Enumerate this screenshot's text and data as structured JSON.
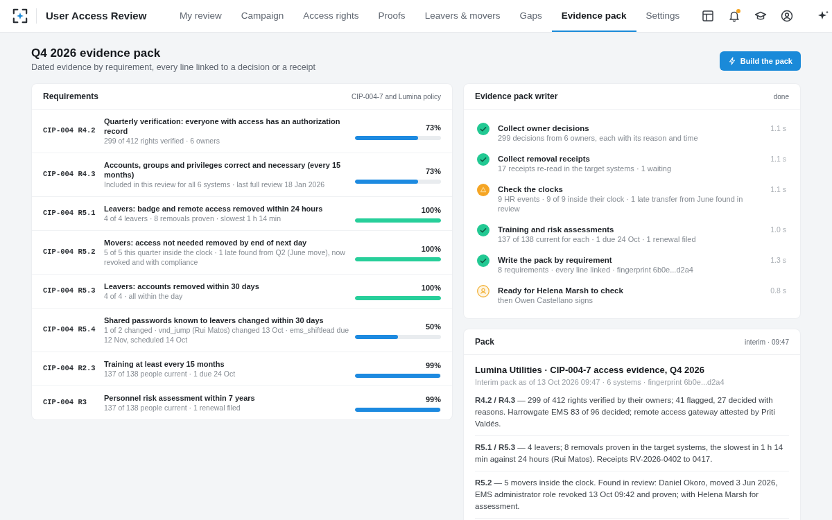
{
  "app": {
    "title": "User Access Review"
  },
  "nav_tabs": [
    {
      "label": "My review",
      "selected": false
    },
    {
      "label": "Campaign",
      "selected": false
    },
    {
      "label": "Access rights",
      "selected": false
    },
    {
      "label": "Proofs",
      "selected": false
    },
    {
      "label": "Leavers & movers",
      "selected": false
    },
    {
      "label": "Gaps",
      "selected": false
    },
    {
      "label": "Evidence pack",
      "selected": true
    },
    {
      "label": "Settings",
      "selected": false
    }
  ],
  "toolbar": {
    "unread_notifications": true
  },
  "header": {
    "title": "Q4 2026 evidence pack",
    "subtitle": "Dated evidence by requirement, every line linked to a decision or a receipt",
    "button": "Build the pack"
  },
  "requirements": {
    "title": "Requirements",
    "source": "CIP-004-7 and Lumina policy",
    "rows": [
      {
        "code": "CIP-004 R4.2",
        "title": "Quarterly verification: everyone with access has an authorization record",
        "detail": "299 of 412 rights verified · 6 owners",
        "percent": "73%",
        "level": 0.73
      },
      {
        "code": "CIP-004 R4.3",
        "title": "Accounts, groups and privileges correct and necessary (every 15 months)",
        "detail": "Included in this review for all 6 systems · last full review 18 Jan 2026",
        "percent": "73%",
        "level": 0.73
      },
      {
        "code": "CIP-004 R5.1",
        "title": "Leavers: badge and remote access removed within 24 hours",
        "detail": "4 of 4 leavers · 8 removals proven · slowest 1 h 14 min",
        "percent": "100%",
        "level": 1
      },
      {
        "code": "CIP-004 R5.2",
        "title": "Movers: access not needed removed by end of next day",
        "detail": "5 of 5 this quarter inside the clock · 1 late found from Q2 (June move), now revoked and with compliance",
        "percent": "100%",
        "level": 1
      },
      {
        "code": "CIP-004 R5.3",
        "title": "Leavers: accounts removed within 30 days",
        "detail": "4 of 4 · all within the day",
        "percent": "100%",
        "level": 1
      },
      {
        "code": "CIP-004 R5.4",
        "title": "Shared passwords known to leavers changed within 30 days",
        "detail": "1 of 2 changed · vnd_jump (Rui Matos) changed 13 Oct · ems_shiftlead due 12 Nov, scheduled 14 Oct",
        "percent": "50%",
        "level": 0.5
      },
      {
        "code": "CIP-004 R2.3",
        "title": "Training at least every 15 months",
        "detail": "137 of 138 people current · 1 due 24 Oct",
        "percent": "99%",
        "level": 0.99
      },
      {
        "code": "CIP-004 R3",
        "title": "Personnel risk assessment within 7 years",
        "detail": "137 of 138 people current · 1 renewal filed",
        "percent": "99%",
        "level": 0.99
      }
    ]
  },
  "writer": {
    "title": "Evidence pack writer",
    "status": "done",
    "steps": [
      {
        "kind": "done",
        "title": "Collect owner decisions",
        "detail": "299 decisions from 6 owners, each with its reason and time",
        "duration": "1.1 s"
      },
      {
        "kind": "done",
        "title": "Collect removal receipts",
        "detail": "17 receipts re-read in the target systems · 1 waiting",
        "duration": "1.1 s"
      },
      {
        "kind": "warning",
        "title": "Check the clocks",
        "detail": "9 HR events · 9 of 9 inside their clock · 1 late transfer from June found in review",
        "duration": "1.1 s"
      },
      {
        "kind": "done",
        "title": "Training and risk assessments",
        "detail": "137 of 138 current for each · 1 due 24 Oct · 1 renewal filed",
        "duration": "1.0 s"
      },
      {
        "kind": "done",
        "title": "Write the pack by requirement",
        "detail": "8 requirements · every line linked · fingerprint 6b0e...d2a4",
        "duration": "1.3 s"
      },
      {
        "kind": "review",
        "title": "Ready for Helena Marsh to check",
        "detail": "then Owen Castellano signs",
        "duration": "0.8 s"
      }
    ]
  },
  "pack": {
    "title": "Pack",
    "status": "interim · 09:47",
    "heading": "Lumina Utilities · CIP-004-7 access evidence, Q4 2026",
    "meta": "Interim pack as of 13 Oct 2026 09:47 · 6 systems · fingerprint 6b0e...d2a4",
    "sections": [
      "**R4.2 / R4.3** — 299 of 412 rights verified by their owners; 41 flagged, 27 decided with reasons. Harrowgate EMS 83 of 96 decided; remote access gateway attested by Priti Valdés.",
      "**R5.1 / R5.3** — 4 leavers; 8 removals proven in the target systems, the slowest in 1 h 14 min against 24 hours (Rui Matos). Receipts RV-2026-0402 to 0417.",
      "**R5.2** — 5 movers inside the clock. Found in review: Daniel Okoro, moved 3 Jun 2026, EMS administrator role revoked 13 Oct 09:42 and proven; with Helena Marsh for assessment."
    ]
  }
}
